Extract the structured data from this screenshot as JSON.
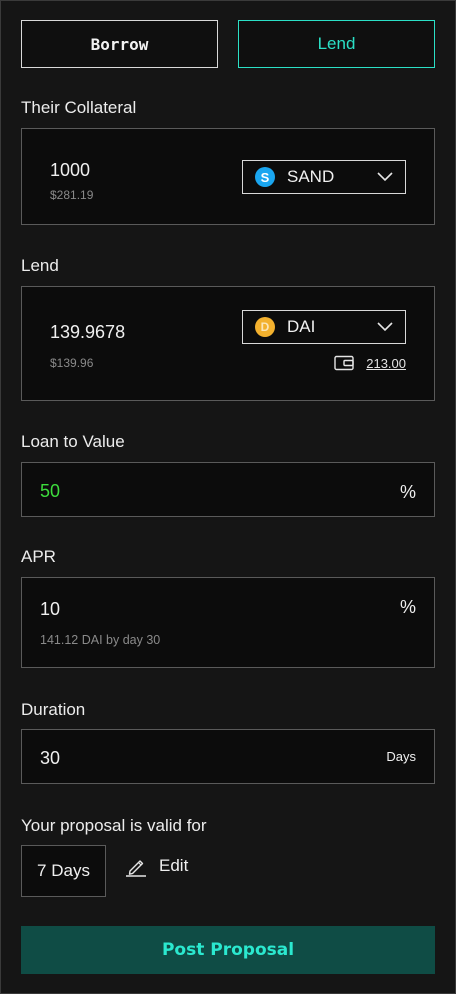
{
  "tabs": {
    "borrow": "Borrow",
    "lend": "Lend"
  },
  "collateral": {
    "label": "Their Collateral",
    "amount": "1000",
    "usd": "$281.19",
    "token": "SAND",
    "icon": "sand-token-icon"
  },
  "lend": {
    "label": "Lend",
    "amount": "139.9678",
    "usd": "$139.96",
    "token": "DAI",
    "icon": "dai-token-icon",
    "wallet_balance": "213.00"
  },
  "ltv": {
    "label": "Loan to Value",
    "value": "50",
    "unit": "%",
    "value_color": "#3ddc3d"
  },
  "apr": {
    "label": "APR",
    "value": "10",
    "unit": "%",
    "hint": "141.12 DAI by day 30"
  },
  "duration": {
    "label": "Duration",
    "value": "30",
    "unit": "Days"
  },
  "validity": {
    "label": "Your proposal is valid for",
    "value": "7 Days",
    "edit_label": "Edit"
  },
  "submit": {
    "label": "Post Proposal"
  },
  "colors": {
    "accent": "#2be0c6",
    "button_bg": "#0f4c45",
    "background": "#151515"
  }
}
